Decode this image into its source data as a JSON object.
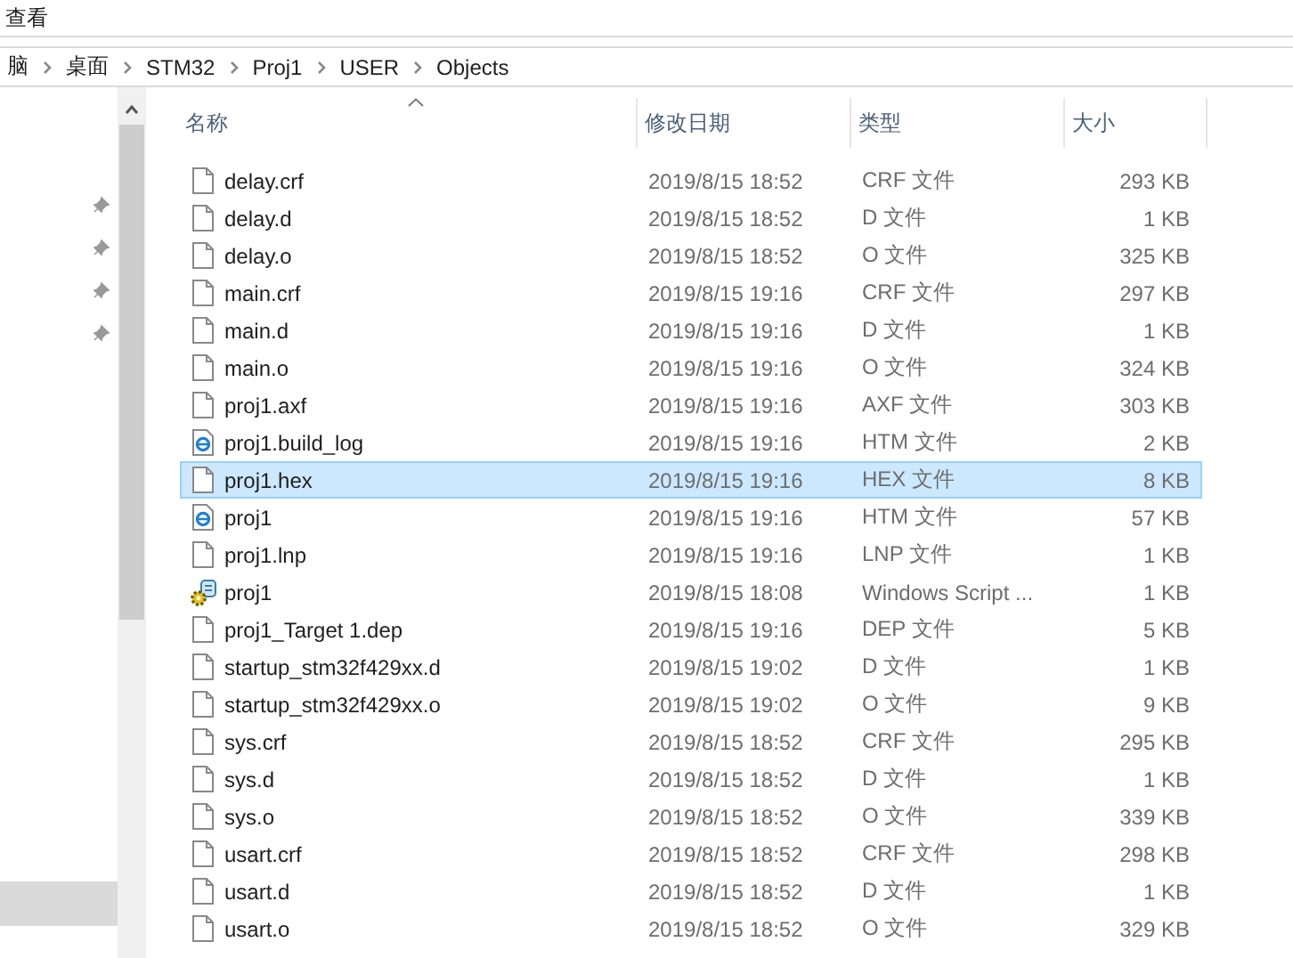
{
  "menu": {
    "label": "查看"
  },
  "breadcrumb": [
    "脑",
    "桌面",
    "STM32",
    "Proj1",
    "USER",
    "Objects"
  ],
  "columns": [
    {
      "label": "名称",
      "sorted": true
    },
    {
      "label": "修改日期",
      "sorted": false
    },
    {
      "label": "类型",
      "sorted": false
    },
    {
      "label": "大小",
      "sorted": false
    }
  ],
  "rows": [
    {
      "name": "delay.crf",
      "modified": "2019/8/15 18:52",
      "type": "CRF 文件",
      "size": "293 KB",
      "kind": "file",
      "selected": false
    },
    {
      "name": "delay.d",
      "modified": "2019/8/15 18:52",
      "type": "D 文件",
      "size": "1 KB",
      "kind": "file",
      "selected": false
    },
    {
      "name": "delay.o",
      "modified": "2019/8/15 18:52",
      "type": "O 文件",
      "size": "325 KB",
      "kind": "file",
      "selected": false
    },
    {
      "name": "main.crf",
      "modified": "2019/8/15 19:16",
      "type": "CRF 文件",
      "size": "297 KB",
      "kind": "file",
      "selected": false
    },
    {
      "name": "main.d",
      "modified": "2019/8/15 19:16",
      "type": "D 文件",
      "size": "1 KB",
      "kind": "file",
      "selected": false
    },
    {
      "name": "main.o",
      "modified": "2019/8/15 19:16",
      "type": "O 文件",
      "size": "324 KB",
      "kind": "file",
      "selected": false
    },
    {
      "name": "proj1.axf",
      "modified": "2019/8/15 19:16",
      "type": "AXF 文件",
      "size": "303 KB",
      "kind": "file",
      "selected": false
    },
    {
      "name": "proj1.build_log",
      "modified": "2019/8/15 19:16",
      "type": "HTM 文件",
      "size": "2 KB",
      "kind": "web",
      "selected": false
    },
    {
      "name": "proj1.hex",
      "modified": "2019/8/15 19:16",
      "type": "HEX 文件",
      "size": "8 KB",
      "kind": "file",
      "selected": true
    },
    {
      "name": "proj1",
      "modified": "2019/8/15 19:16",
      "type": "HTM 文件",
      "size": "57 KB",
      "kind": "web",
      "selected": false
    },
    {
      "name": "proj1.lnp",
      "modified": "2019/8/15 19:16",
      "type": "LNP 文件",
      "size": "1 KB",
      "kind": "file",
      "selected": false
    },
    {
      "name": "proj1",
      "modified": "2019/8/15 18:08",
      "type": "Windows Script ...",
      "size": "1 KB",
      "kind": "script",
      "selected": false
    },
    {
      "name": "proj1_Target 1.dep",
      "modified": "2019/8/15 19:16",
      "type": "DEP 文件",
      "size": "5 KB",
      "kind": "file",
      "selected": false
    },
    {
      "name": "startup_stm32f429xx.d",
      "modified": "2019/8/15 19:02",
      "type": "D 文件",
      "size": "1 KB",
      "kind": "file",
      "selected": false
    },
    {
      "name": "startup_stm32f429xx.o",
      "modified": "2019/8/15 19:02",
      "type": "O 文件",
      "size": "9 KB",
      "kind": "file",
      "selected": false
    },
    {
      "name": "sys.crf",
      "modified": "2019/8/15 18:52",
      "type": "CRF 文件",
      "size": "295 KB",
      "kind": "file",
      "selected": false
    },
    {
      "name": "sys.d",
      "modified": "2019/8/15 18:52",
      "type": "D 文件",
      "size": "1 KB",
      "kind": "file",
      "selected": false
    },
    {
      "name": "sys.o",
      "modified": "2019/8/15 18:52",
      "type": "O 文件",
      "size": "339 KB",
      "kind": "file",
      "selected": false
    },
    {
      "name": "usart.crf",
      "modified": "2019/8/15 18:52",
      "type": "CRF 文件",
      "size": "298 KB",
      "kind": "file",
      "selected": false
    },
    {
      "name": "usart.d",
      "modified": "2019/8/15 18:52",
      "type": "D 文件",
      "size": "1 KB",
      "kind": "file",
      "selected": false
    },
    {
      "name": "usart.o",
      "modified": "2019/8/15 18:52",
      "type": "O 文件",
      "size": "329 KB",
      "kind": "file",
      "selected": false
    }
  ]
}
